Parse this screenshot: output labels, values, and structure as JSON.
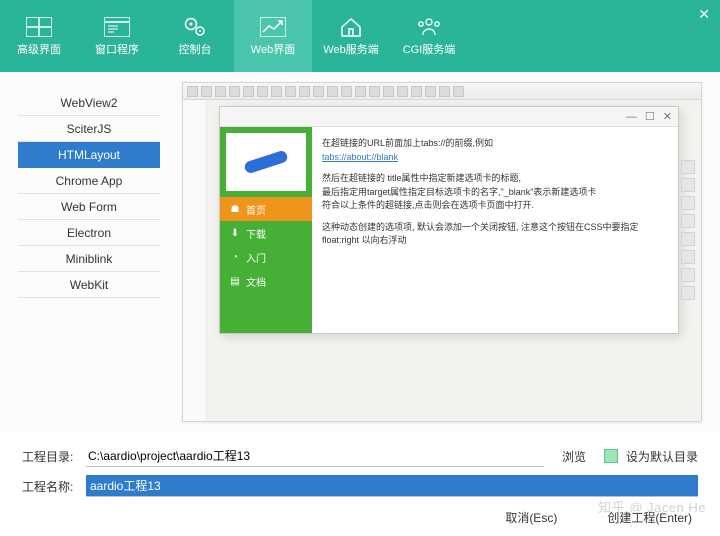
{
  "topbar": {
    "items": [
      {
        "name": "adv-ui",
        "label": "高级界面"
      },
      {
        "name": "window-prog",
        "label": "窗口程序"
      },
      {
        "name": "console",
        "label": "控制台"
      },
      {
        "name": "web-ui",
        "label": "Web界面"
      },
      {
        "name": "web-server",
        "label": "Web服务端"
      },
      {
        "name": "cgi-server",
        "label": "CGI服务端"
      }
    ],
    "selected": "web-ui"
  },
  "sidebar": {
    "items": [
      "WebView2",
      "SciterJS",
      "HTMLayout",
      "Chrome App",
      "Web Form",
      "Electron",
      "Miniblink",
      "WebKit"
    ],
    "selected": "HTMLayout"
  },
  "demo": {
    "nav": {
      "items": [
        {
          "icon": "home-icon",
          "label": "首页",
          "hl": true
        },
        {
          "icon": "download-icon",
          "label": "下载",
          "hl": false
        },
        {
          "icon": "enter-icon",
          "label": "入门",
          "hl": false
        },
        {
          "icon": "doc-icon",
          "label": "文档",
          "hl": false
        }
      ]
    },
    "content": {
      "line1": "在超链接的URL前面加上tabs://的前缀,例如",
      "link": "tabs://about://blank",
      "line2": "然后在超链接的 title属性中指定新建选项卡的标题,",
      "line3": "最后指定用target属性指定目标选项卡的名字,\"_blank\"表示新建选项卡",
      "line4": "符合以上条件的超链接,点击则会在选项卡页面中打开.",
      "line5": "这种动态创建的选项项, 默认会添加一个关闭按钮, 注意这个按钮在CSS中要指定 float:right 以向右浮动"
    }
  },
  "fields": {
    "dir_label": "工程目录:",
    "dir_value": "C:\\aardio\\project\\aardio工程13",
    "name_label": "工程名称:",
    "name_value": "aardio工程13",
    "browse": "浏览",
    "default": "设为默认目录"
  },
  "actions": {
    "cancel": "取消(Esc)",
    "create": "创建工程(Enter)"
  },
  "watermark": "知乎 @ Jacen He"
}
